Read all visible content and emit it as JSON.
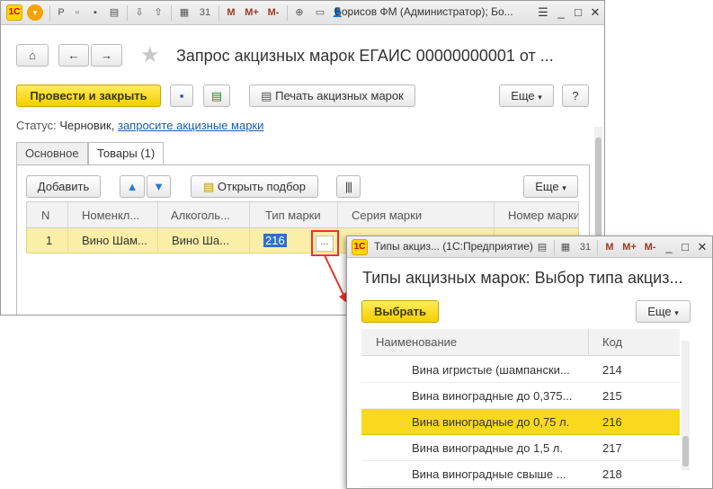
{
  "main": {
    "titlebar": {
      "user": "Борисов ФМ (Администратор); Бо..."
    },
    "nav": {
      "home_icon": "home-icon",
      "back_icon": "arrow-left-icon",
      "forward_icon": "arrow-right-icon"
    },
    "title": "Запрос акцизных марок ЕГАИС 00000000001 от ...",
    "toolbar": {
      "post_close": "Провести и закрыть",
      "print_marks": "Печать акцизных марок",
      "more": "Еще",
      "help": "?"
    },
    "status": {
      "label": "Статус:",
      "value": "Черновик,",
      "link": "запросите акцизные марки"
    },
    "tabs": [
      {
        "label": "Основное"
      },
      {
        "label": "Товары (1)"
      }
    ],
    "goods_toolbar": {
      "add": "Добавить",
      "open_selection": "Открыть подбор",
      "more": "Еще"
    },
    "table": {
      "columns": [
        "N",
        "Номенкл...",
        "Алкоголь...",
        "Тип марки",
        "Серия марки",
        "Номер марки"
      ],
      "rows": [
        {
          "n": "1",
          "item": "Вино Шам...",
          "alco": "Вино Ша...",
          "mark_type": "216",
          "series": "",
          "number": ""
        }
      ],
      "choice_button": "..."
    }
  },
  "popup": {
    "title": "Типы акциз... (1С:Предприятие)",
    "heading": "Типы акцизных марок: Выбор типа акциз...",
    "select_button": "Выбрать",
    "more": "Еще",
    "columns": [
      "Наименование",
      "Код"
    ],
    "rows": [
      {
        "name": "Вина игристые (шампански...",
        "code": "214",
        "selected": false
      },
      {
        "name": "Вина виноградные до 0,375...",
        "code": "215",
        "selected": false
      },
      {
        "name": "Вина виноградные до 0,75 л.",
        "code": "216",
        "selected": true
      },
      {
        "name": "Вина виноградные до 1,5 л.",
        "code": "217",
        "selected": false
      },
      {
        "name": "Вина виноградные свыше ...",
        "code": "218",
        "selected": false
      }
    ]
  },
  "colors": {
    "accent_yellow": "#f5cf00",
    "selection_blue": "#2f6fc8",
    "highlight_red": "#e8332a",
    "link": "#1a5fa8"
  }
}
